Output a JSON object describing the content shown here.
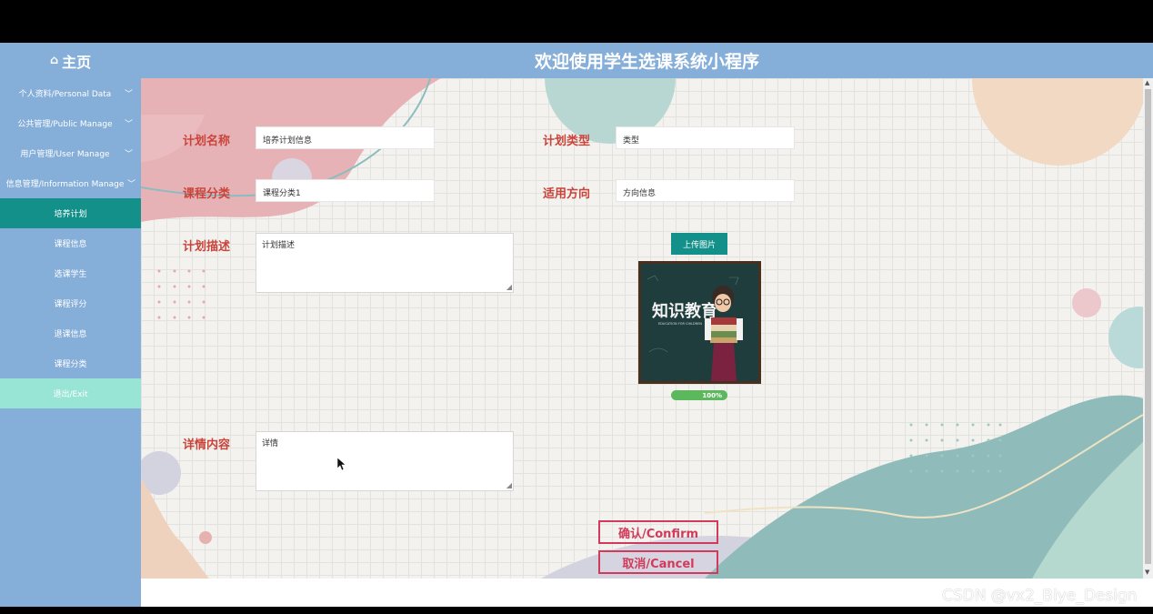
{
  "header": {
    "home_label": "主页",
    "home_icon": "home-icon",
    "title": "欢迎使用学生选课系统小程序"
  },
  "sidebar": {
    "items": [
      {
        "label": "个人资料/Personal Data",
        "chevron": true
      },
      {
        "label": "公共管理/Public Manage",
        "chevron": true
      },
      {
        "label": "用户管理/User Manage",
        "chevron": true
      },
      {
        "label": "信息管理/Information Manage",
        "chevron": true
      },
      {
        "label": "培养计划"
      },
      {
        "label": "课程信息"
      },
      {
        "label": "选课学生"
      },
      {
        "label": "课程评分"
      },
      {
        "label": "退课信息"
      },
      {
        "label": "课程分类"
      },
      {
        "label": "退出/Exit"
      }
    ]
  },
  "form": {
    "plan_name_label": "计划名称",
    "plan_name_value": "培养计划信息",
    "plan_type_label": "计划类型",
    "plan_type_value": "类型",
    "course_category_label": "课程分类",
    "course_category_value": "课程分类1",
    "direction_label": "适用方向",
    "direction_value": "方向信息",
    "plan_desc_label": "计划描述",
    "plan_desc_value": "计划描述",
    "detail_label": "详情内容",
    "detail_value": "详情",
    "upload_button": "上传图片",
    "upload_progress": "100%",
    "image_title": "知识教育",
    "image_subtitle": "EDUCATION FOR CHILDREN",
    "confirm_button": "确认/Confirm",
    "cancel_button": "取消/Cancel"
  },
  "colors": {
    "header_bg": "#85aed9",
    "active_item": "#14908a",
    "exit_item": "#98e4d5",
    "label_red": "#c9443b",
    "button_red": "#d23a5c",
    "progress_green": "#5cb85c"
  },
  "watermark": "CSDN @vx2_Biye_Design"
}
